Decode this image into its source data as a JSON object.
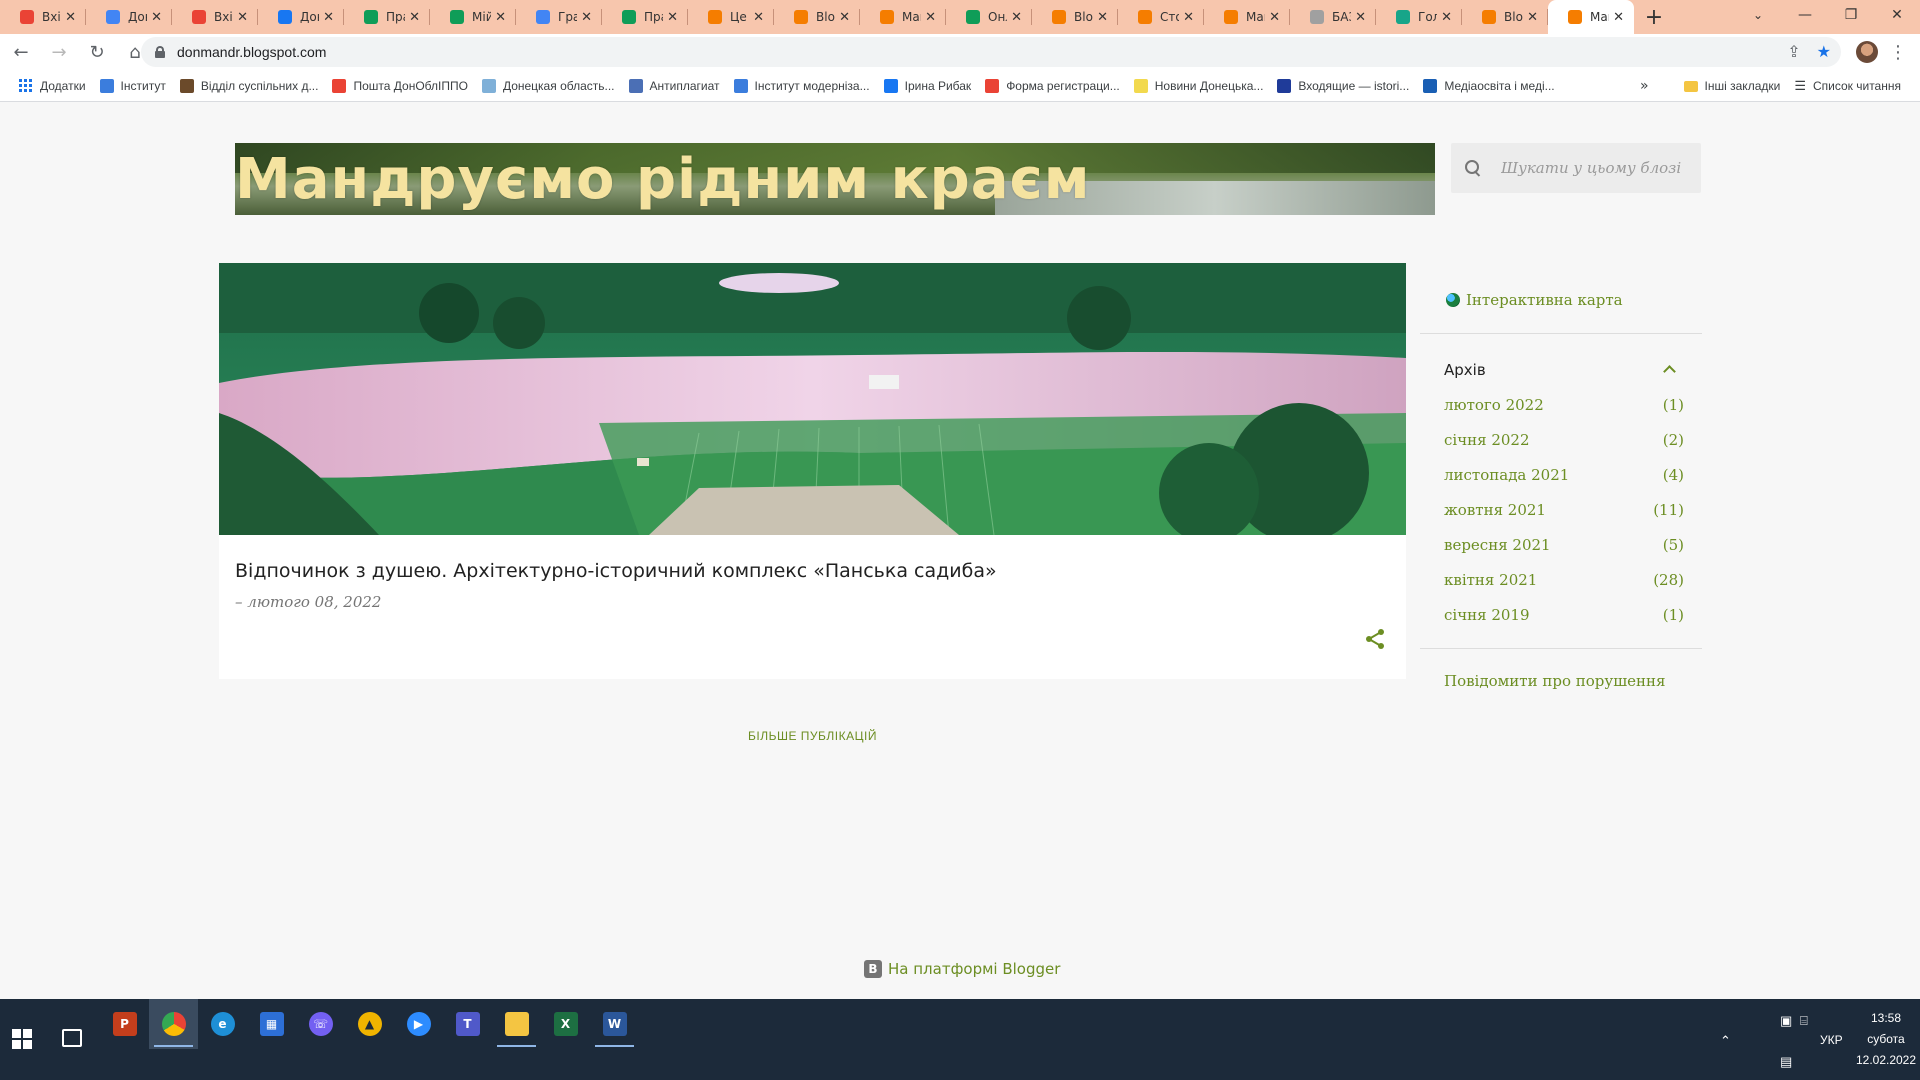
{
  "browser": {
    "tabs": [
      {
        "label": "Вхід",
        "icon_color": "#ea4335",
        "icon": "gmail-icon"
      },
      {
        "label": "Дон",
        "icon_color": "#4285f4",
        "icon": "calendar-icon"
      },
      {
        "label": "Вхід",
        "icon_color": "#ea4335",
        "icon": "gmail-icon"
      },
      {
        "label": "Дон",
        "icon_color": "#1877f2",
        "icon": "facebook-icon"
      },
      {
        "label": "Пра",
        "icon_color": "#0f9d58",
        "icon": "drive-icon"
      },
      {
        "label": "Мій",
        "icon_color": "#0f9d58",
        "icon": "drive-icon"
      },
      {
        "label": "Граф",
        "icon_color": "#4285f4",
        "icon": "docs-icon"
      },
      {
        "label": "Пра",
        "icon_color": "#0f9d58",
        "icon": "drive-icon"
      },
      {
        "label": "Це з",
        "icon_color": "#f57d00",
        "icon": "blogger-icon"
      },
      {
        "label": "Blog",
        "icon_color": "#f57d00",
        "icon": "blogger-icon"
      },
      {
        "label": "Ман",
        "icon_color": "#f57d00",
        "icon": "blogger-icon"
      },
      {
        "label": "Онл",
        "icon_color": "#0f9d58",
        "icon": "drive-icon"
      },
      {
        "label": "Blog",
        "icon_color": "#f57d00",
        "icon": "blogger-icon"
      },
      {
        "label": "Стор",
        "icon_color": "#f57d00",
        "icon": "blogger-icon"
      },
      {
        "label": "Ман",
        "icon_color": "#f57d00",
        "icon": "blogger-icon"
      },
      {
        "label": "БАЗ",
        "icon_color": "#a0a0a0",
        "icon": "site-icon"
      },
      {
        "label": "Голо",
        "icon_color": "#17a589",
        "icon": "site-icon"
      },
      {
        "label": "Blog",
        "icon_color": "#f57d00",
        "icon": "blogger-icon"
      },
      {
        "label": "Ман",
        "icon_color": "#f57d00",
        "icon": "blogger-icon",
        "active": true
      }
    ],
    "new_tab_label": "+",
    "url": "donmandr.blogspot.com",
    "bookmarks": [
      {
        "label": "Додатки",
        "icon_color": "#1a73e8"
      },
      {
        "label": "Інститут",
        "icon_color": "#3b7ddd"
      },
      {
        "label": "Відділ суспільних д...",
        "icon_color": "#6b4a2a"
      },
      {
        "label": "Пошта ДонОблІППО",
        "icon_color": "#ea4335"
      },
      {
        "label": "Донецкая область...",
        "icon_color": "#7fb0d8"
      },
      {
        "label": "Антиплагиат",
        "icon_color": "#4b6fb5"
      },
      {
        "label": "Інститут модернiза...",
        "icon_color": "#3b7ddd"
      },
      {
        "label": "Ірина Рибак",
        "icon_color": "#1877f2"
      },
      {
        "label": "Форма регистраци...",
        "icon_color": "#ea4335"
      },
      {
        "label": "Новини Донецька...",
        "icon_color": "#f2d94e"
      },
      {
        "label": "Входящие — istori...",
        "icon_color": "#1f3b99"
      },
      {
        "label": "Медіаосвіта і меді...",
        "icon_color": "#1a5fb4"
      }
    ],
    "bookmarks_more": "»",
    "other_bookmarks": "Інші закладки",
    "reading_list": "Список читання"
  },
  "blog": {
    "title": "Мандруємо рідним краєм",
    "search_placeholder": "Шукати у цьому блозі",
    "post": {
      "title": "Відпочинок з душею. Архітектурно-історичний комплекс «Панська садиба»",
      "date": "– лютого 08, 2022"
    },
    "more_posts": "Більше публікацій",
    "sidebar": {
      "map_link": "Інтерактивна карта",
      "archive_title": "Архів",
      "archive": [
        {
          "month": "лютого 2022",
          "count": "(1)"
        },
        {
          "month": "січня 2022",
          "count": "(2)"
        },
        {
          "month": "листопада 2021",
          "count": "(4)"
        },
        {
          "month": "жовтня 2021",
          "count": "(11)"
        },
        {
          "month": "вересня 2021",
          "count": "(5)"
        },
        {
          "month": "квітня 2021",
          "count": "(28)"
        },
        {
          "month": "січня 2019",
          "count": "(1)"
        }
      ],
      "report_link": "Повідомити про порушення"
    },
    "footer": "На платформі Blogger",
    "accent_color": "#6c8e23"
  },
  "taskbar": {
    "apps": [
      {
        "name": "powerpoint-icon",
        "color": "#c43e1c",
        "glyph": "P"
      },
      {
        "name": "chrome-icon",
        "color": "#4285f4",
        "glyph": "",
        "active": true
      },
      {
        "name": "edge-icon",
        "color": "#1e8fd6",
        "glyph": "e"
      },
      {
        "name": "store-icon",
        "color": "#2d6fd6",
        "glyph": "▦"
      },
      {
        "name": "viber-icon",
        "color": "#7360f2",
        "glyph": "☏"
      },
      {
        "name": "app-icon",
        "color": "#f0b400",
        "glyph": "▲"
      },
      {
        "name": "zoom-icon",
        "color": "#2d8cff",
        "glyph": "▶"
      },
      {
        "name": "teams-icon",
        "color": "#5059c9",
        "glyph": "T"
      },
      {
        "name": "explorer-icon",
        "color": "#f4c542",
        "glyph": "",
        "underline": true
      },
      {
        "name": "excel-icon",
        "color": "#1d6f42",
        "glyph": "X"
      },
      {
        "name": "word-icon",
        "color": "#2b579a",
        "glyph": "W",
        "underline": true
      }
    ],
    "language": "УКР",
    "time": "13:58",
    "day": "субота",
    "date": "12.02.2022"
  }
}
